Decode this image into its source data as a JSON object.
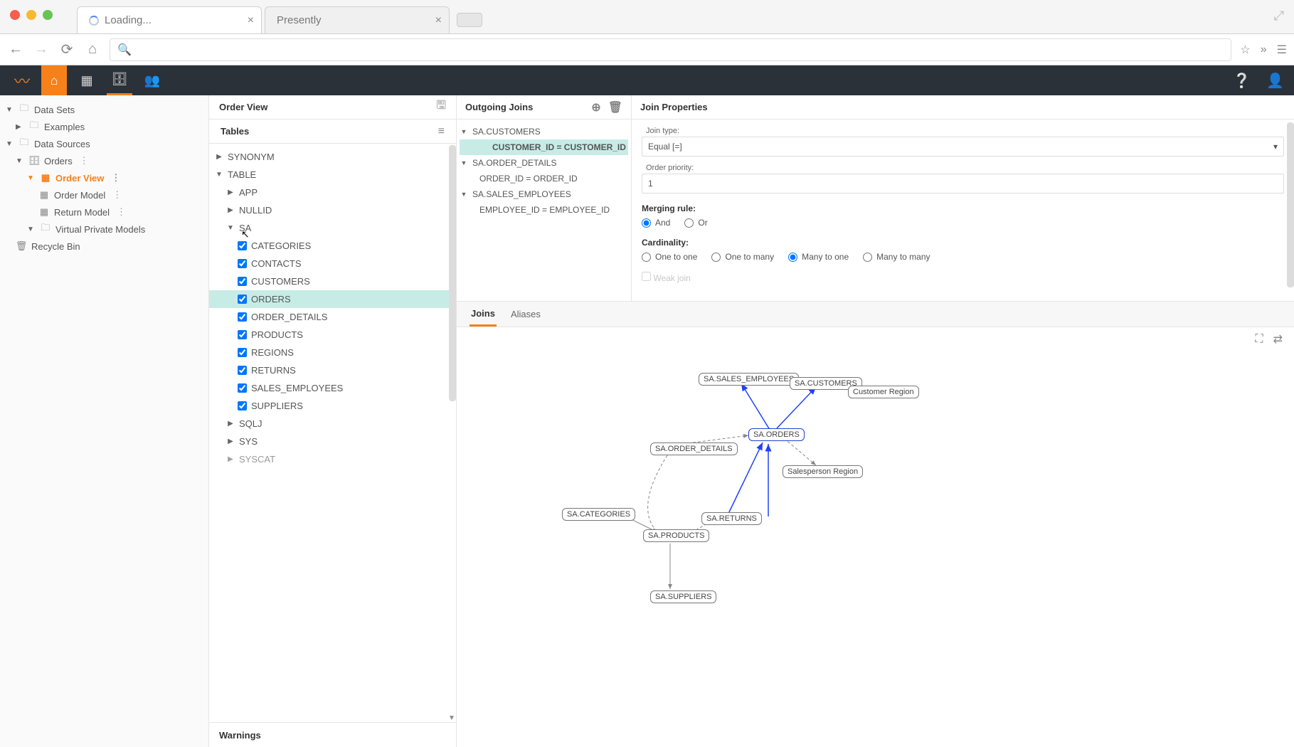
{
  "browser": {
    "tabs": [
      {
        "label": "Loading..."
      },
      {
        "label": "Presently"
      }
    ]
  },
  "sidebar": {
    "items": {
      "datasets": "Data Sets",
      "examples": "Examples",
      "datasources": "Data Sources",
      "orders": "Orders",
      "order_view": "Order View",
      "order_model": "Order Model",
      "return_model": "Return Model",
      "vpm": "Virtual Private Models",
      "recycle": "Recycle Bin"
    }
  },
  "center": {
    "title": "Order View",
    "tables_label": "Tables",
    "warnings_label": "Warnings",
    "schemas": {
      "synonym": "SYNONYM",
      "table": "TABLE",
      "app": "APP",
      "nullid": "NULLID",
      "sa": "SA",
      "sqlj": "SQLJ",
      "sys": "SYS",
      "syscat": "SYSCAT"
    },
    "tables": [
      "CATEGORIES",
      "CONTACTS",
      "CUSTOMERS",
      "ORDERS",
      "ORDER_DETAILS",
      "PRODUCTS",
      "REGIONS",
      "RETURNS",
      "SALES_EMPLOYEES",
      "SUPPLIERS"
    ]
  },
  "joins": {
    "header": "Outgoing Joins",
    "list": [
      {
        "name": "SA.CUSTOMERS",
        "condition": "CUSTOMER_ID = CUSTOMER_ID",
        "selected": true
      },
      {
        "name": "SA.ORDER_DETAILS",
        "condition": "ORDER_ID = ORDER_ID"
      },
      {
        "name": "SA.SALES_EMPLOYEES",
        "condition": "EMPLOYEE_ID = EMPLOYEE_ID"
      }
    ]
  },
  "props": {
    "header": "Join Properties",
    "join_type_label": "Join type:",
    "join_type_value": "Equal [=]",
    "order_priority_label": "Order priority:",
    "order_priority_value": "1",
    "merging_rule_label": "Merging rule:",
    "merging_and": "And",
    "merging_or": "Or",
    "merging_selected": "and",
    "cardinality_label": "Cardinality:",
    "cardinality": {
      "one_to_one": "One to one",
      "one_to_many": "One to many",
      "many_to_one": "Many to one",
      "many_to_many": "Many to many",
      "selected": "many_to_one"
    },
    "weak_join": "Weak join"
  },
  "diagram": {
    "tab_joins": "Joins",
    "tab_aliases": "Aliases",
    "nodes": {
      "sales_emp": "SA.SALES_EMPLOYEES",
      "customers": "SA.CUSTOMERS",
      "cust_region": "Customer Region",
      "orders": "SA.ORDERS",
      "order_details": "SA.ORDER_DETAILS",
      "sales_region": "Salesperson Region",
      "categories": "SA.CATEGORIES",
      "products": "SA.PRODUCTS",
      "returns": "SA.RETURNS",
      "suppliers": "SA.SUPPLIERS"
    }
  }
}
